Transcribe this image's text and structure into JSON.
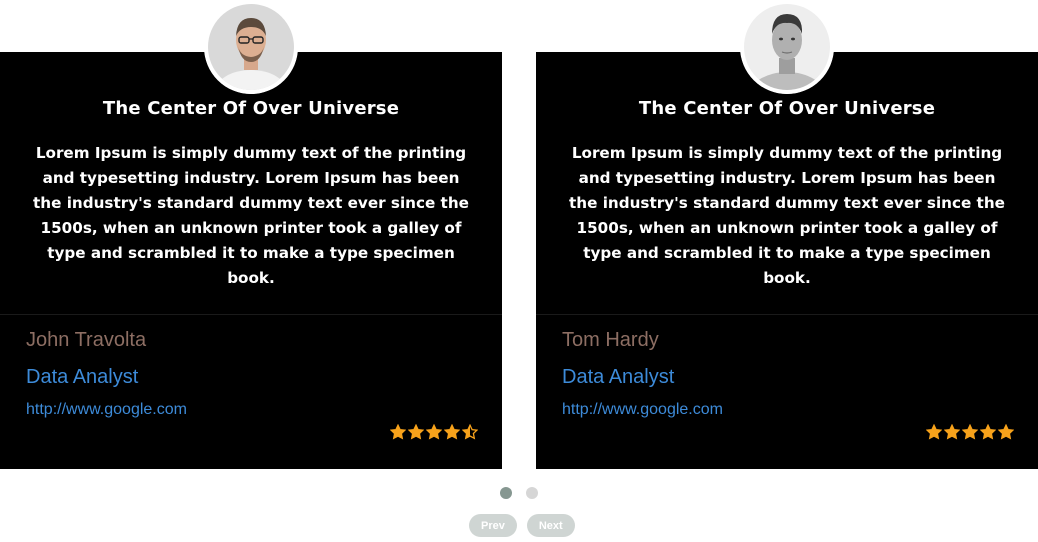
{
  "cards": [
    {
      "avatar_icon": "person-portrait-glasses",
      "title": "The Center Of Over Universe",
      "text": "Lorem Ipsum is simply dummy text of the printing and typesetting industry. Lorem Ipsum has been the industry's standard dummy text ever since the 1500s, when an unknown printer took a galley of type and scrambled it to make a type specimen book.",
      "name": "John Travolta",
      "role": "Data Analyst",
      "link": "http://www.google.com",
      "rating": 4.5
    },
    {
      "avatar_icon": "person-portrait-bw",
      "title": "The Center Of Over Universe",
      "text": "Lorem Ipsum is simply dummy text of the printing and typesetting industry. Lorem Ipsum has been the industry's standard dummy text ever since the 1500s, when an unknown printer took a galley of type and scrambled it to make a type specimen book.",
      "name": "Tom Hardy",
      "role": "Data Analyst",
      "link": "http://www.google.com",
      "rating": 5
    }
  ],
  "pagination": {
    "total": 2,
    "active": 1
  },
  "nav": {
    "prev_label": "Prev",
    "next_label": "Next"
  },
  "colors": {
    "card_bg": "#000000",
    "name": "#8d6e63",
    "accent_blue": "#3d8bd9",
    "star": "#f7a21b",
    "dot_active": "#869791",
    "dot_inactive": "#d6d6d6",
    "nav_button": "#cfd5d3"
  }
}
